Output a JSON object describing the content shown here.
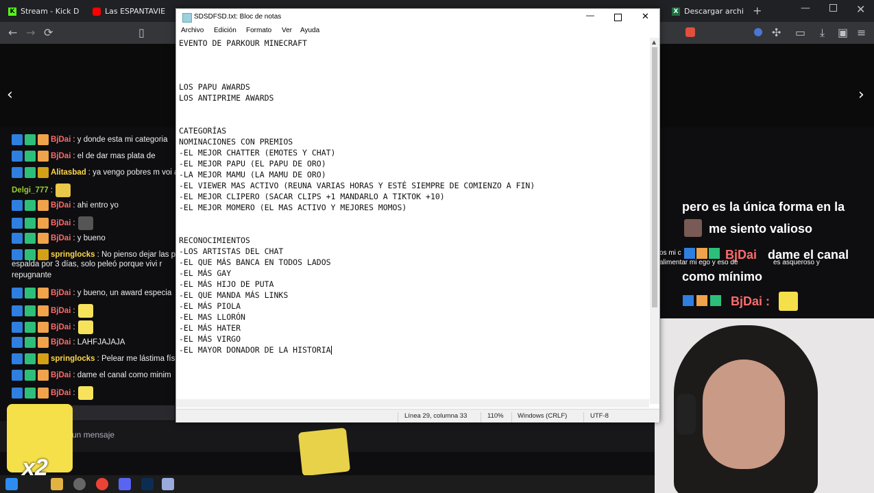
{
  "browser": {
    "tabs": [
      {
        "label": "Stream - Kick D"
      },
      {
        "label": "Las ESPANTAVIE"
      },
      {
        "label": "Descargar archi"
      }
    ]
  },
  "chat": {
    "messages": [
      {
        "user": "BjDai",
        "text": "y donde esta mi categoria"
      },
      {
        "user": "BjDai",
        "text": "el de dar mas plata de"
      },
      {
        "user": "Alitasbad",
        "text": "ya vengo pobres m voi a s"
      },
      {
        "user": "Delgi_777",
        "text": ""
      },
      {
        "user": "BjDai",
        "text": "ahi entro yo"
      },
      {
        "user": "BjDai",
        "text": ""
      },
      {
        "user": "BjDai",
        "text": "y bueno"
      },
      {
        "user": "springlocks",
        "text": "No pienso dejar las pele"
      },
      {
        "user": "",
        "text": "espalda por 3 días, solo peleó porque vivi r"
      },
      {
        "user": "",
        "text": "repugnante"
      },
      {
        "user": "BjDai",
        "text": "y bueno, un award especia"
      },
      {
        "user": "BjDai",
        "text": ""
      },
      {
        "user": "BjDai",
        "text": ""
      },
      {
        "user": "BjDai",
        "text": "LAHFJAJAJA"
      },
      {
        "user": "springlocks",
        "text": "Pelear me lástima física"
      },
      {
        "user": "BjDai",
        "text": "dame el canal como minim"
      },
      {
        "user": "BjDai",
        "text": ""
      }
    ],
    "input_placeholder": "un mensaje",
    "multiplier": "x2"
  },
  "overlay": {
    "line1": "pero es la única forma en la",
    "line2": "me siento valioso",
    "small1": "os mi c",
    "small2": "alimentar mi ego y eso de",
    "small3": "es asqueroso y",
    "user": "BjDai",
    "text1": "dame el canal",
    "text2": "como mínimo",
    "user2": "BjDai :"
  },
  "notepad": {
    "title": "SDSDFSD.txt: Bloc de notas",
    "menu": [
      "Archivo",
      "Edición",
      "Formato",
      "Ver",
      "Ayuda"
    ],
    "lines": [
      "EVENTO DE PARKOUR MINECRAFT",
      "",
      "",
      "",
      "LOS PAPU AWARDS",
      "LOS ANTIPRIME AWARDS",
      "",
      "",
      "CATEGORÍAS",
      "NOMINACIONES CON PREMIOS",
      "-EL MEJOR CHATTER (EMOTES Y CHAT)",
      "-EL MEJOR PAPU (EL PAPU DE ORO)",
      "-LA MEJOR MAMU (LA MAMU DE ORO)",
      "-EL VIEWER MAS ACTIVO (REUNA VARIAS HORAS Y ESTÉ SIEMPRE DE COMIENZO A FIN)",
      "-EL MEJOR CLIPERO (SACAR CLIPS +1 MANDARLO A TIKTOK +10)",
      "-EL MEJOR MOMERO (EL MAS ACTIVO Y MEJORES MOMOS)",
      "",
      "",
      "RECONOCIMIENTOS",
      "-LOS ARTISTAS DEL CHAT",
      "-EL QUE MÁS BANCA EN TODOS LADOS",
      "-EL MÁS GAY",
      "-EL MÁS HIJO DE PUTA",
      "-EL QUE MANDA MÁS LINKS",
      "-EL MÁS PIOLA",
      "-EL MAS LLORÓN",
      "-EL MÁS HATER",
      "-EL MÁS VIRGO",
      "-EL MAYOR DONADOR DE LA HISTORIA"
    ],
    "status": {
      "position": "Línea 29, columna 33",
      "zoom": "110%",
      "eol": "Windows (CRLF)",
      "encoding": "UTF-8"
    }
  }
}
